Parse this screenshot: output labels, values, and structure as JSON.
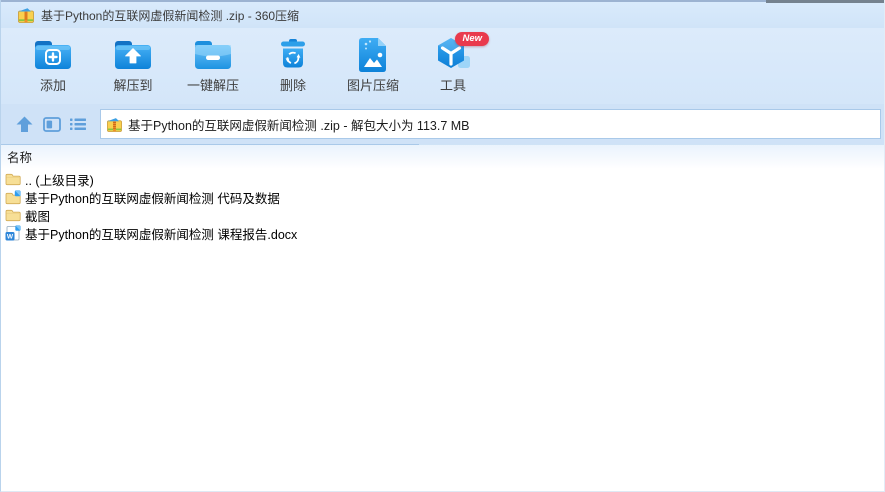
{
  "window": {
    "title": "基于Python的互联网虚假新闻检测 .zip - 360压缩",
    "app_icon": "archive-zip-icon"
  },
  "toolbar": {
    "buttons": [
      {
        "label": "添加",
        "icon": "add-folder-icon"
      },
      {
        "label": "解压到",
        "icon": "extract-to-folder-icon"
      },
      {
        "label": "一键解压",
        "icon": "one-click-extract-folder-icon"
      },
      {
        "label": "删除",
        "icon": "delete-trash-icon"
      },
      {
        "label": "图片压缩",
        "icon": "image-compress-icon"
      },
      {
        "label": "工具",
        "icon": "tools-cube-icon",
        "badge": "New"
      }
    ]
  },
  "addressbar": {
    "nav_icons": [
      "up-arrow-icon",
      "preview-pane-icon",
      "list-view-icon"
    ],
    "file_icon": "archive-zip-icon",
    "value": "基于Python的互联网虚假新闻检测 .zip - 解包大小为 113.7 MB"
  },
  "filelist": {
    "columns": [
      {
        "label": "名称"
      }
    ],
    "rows": [
      {
        "icon": "folder-icon",
        "name": ".. (上级目录)"
      },
      {
        "icon": "folder-badge-icon",
        "name": "基于Python的互联网虚假新闻检测 代码及数据"
      },
      {
        "icon": "folder-icon",
        "name": "截图"
      },
      {
        "icon": "word-docx-icon",
        "name": "基于Python的互联网虚假新闻检测 课程报告.docx"
      }
    ]
  },
  "colors": {
    "accent_blue": "#1e96e8",
    "titlebar_bg": "#d4e6f9",
    "addressrow_bg": "#cfe2f7",
    "folder_yellow": "#f7df96",
    "badge_red": "#e93a4d",
    "nav_icon_blue": "#5f9fdb"
  }
}
